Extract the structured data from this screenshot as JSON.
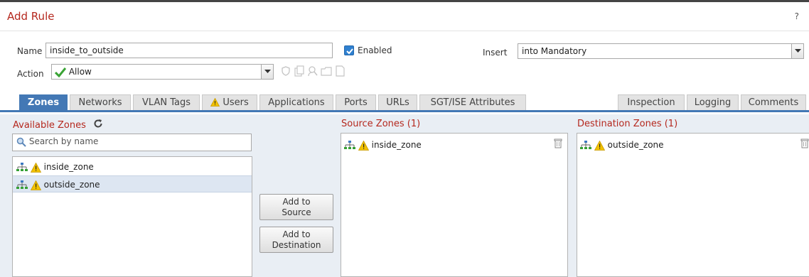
{
  "dialog": {
    "title": "Add Rule",
    "help": "?"
  },
  "rule": {
    "name_label": "Name",
    "name_value": "inside_to_outside",
    "enabled_label": "Enabled",
    "insert_label": "Insert",
    "insert_value": "into Mandatory",
    "action_label": "Action",
    "action_value": "Allow"
  },
  "tabs": [
    {
      "label": "Zones",
      "active": true
    },
    {
      "label": "Networks"
    },
    {
      "label": "VLAN Tags"
    },
    {
      "label": "Users",
      "warning": true
    },
    {
      "label": "Applications"
    },
    {
      "label": "Ports"
    },
    {
      "label": "URLs"
    },
    {
      "label": "SGT/ISE Attributes"
    },
    {
      "label": "Inspection"
    },
    {
      "label": "Logging"
    },
    {
      "label": "Comments"
    }
  ],
  "available": {
    "header": "Available Zones",
    "search_placeholder": "Search by name",
    "items": [
      "inside_zone",
      "outside_zone"
    ],
    "selected_item": "outside_zone"
  },
  "buttons": {
    "add_source": [
      "Add to",
      "Source"
    ],
    "add_destination": [
      "Add to",
      "Destination"
    ]
  },
  "source": {
    "header": "Source Zones (1)",
    "items": [
      "inside_zone"
    ]
  },
  "destination": {
    "header": "Destination Zones (1)",
    "items": [
      "outside_zone"
    ]
  },
  "colors": {
    "accent": "#4378b5",
    "title_red": "#b5281e",
    "warning": "#f2c200",
    "allow_green": "#3aa335"
  }
}
